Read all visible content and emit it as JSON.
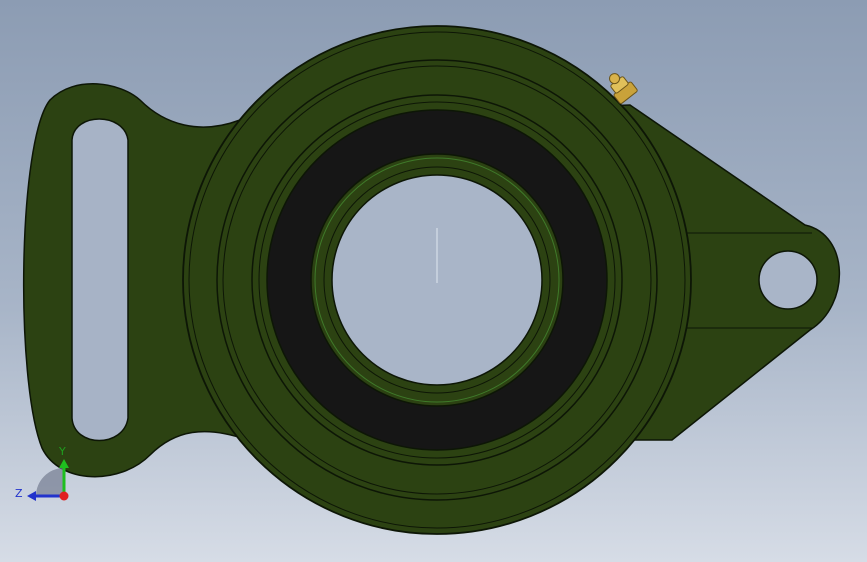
{
  "viewport": {
    "part_color": "#2c4212",
    "edge_color": "#0d1606",
    "seal_color": "#161616",
    "grease_fitting_color": "#c9a23a",
    "background_top": "#8c9cb3",
    "background_bottom": "#d6dce6"
  },
  "triad": {
    "y_label": "Y",
    "z_label": "Z",
    "x_color": "#e02020",
    "y_color": "#1fbf1f",
    "z_color": "#2233cc"
  }
}
